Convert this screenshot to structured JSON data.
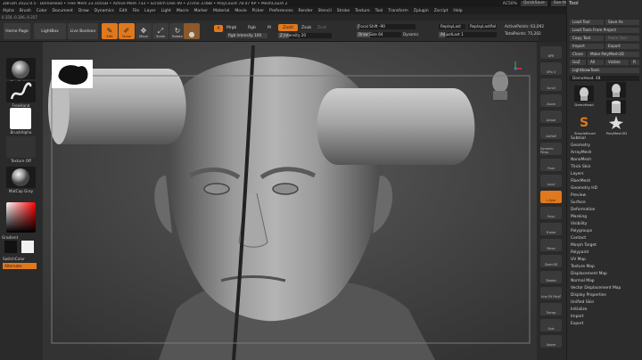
{
  "title_bar": {
    "text": "ZBrush 2022.0.5 · DemoHead • Free Mem 23.165GB • Active Mem 733 • Scratch Disk 49 • ZTime 3.088 • PolyCount 78.07 KP • MeshCount 2",
    "ac50": "AC50%",
    "quicksave": "QuickSave",
    "see_through": "See-through 0",
    "menus": "Menus",
    "default_zscript": "DefaultZScript"
  },
  "menubar": {
    "items": [
      "Alpha",
      "Brush",
      "Color",
      "Document",
      "Draw",
      "Dynamics",
      "Edit",
      "File",
      "Layer",
      "Light",
      "Macro",
      "Marker",
      "Material",
      "Movie",
      "Picker",
      "Preferences",
      "Render",
      "Stencil",
      "Stroke",
      "Texture",
      "Tool",
      "Transform",
      "Zplugin",
      "Zscript",
      "Help"
    ]
  },
  "coord_readout": "0.350,-0.306,-0.357",
  "toolbar": {
    "home_page": "Home Page",
    "lightbox": "LightBox",
    "live_boolean": "Live Boolean",
    "edit": "Edit",
    "draw": "Draw",
    "move": "Move",
    "scale": "Scale",
    "rotate": "Rotate",
    "a_label": "A",
    "mrgb": "Mrgb",
    "rgb": "Rgb",
    "m": "M",
    "zadd": "Zadd",
    "zsub": "Zsub",
    "zcut": "Zcut",
    "rgb_intensity": "Rgb Intensity 100",
    "z_intensity": "Z Intensity 20",
    "z_intensity_value": 20,
    "focal_shift": "Focal Shift -90",
    "focal_shift_value": -90,
    "draw_size": "Draw Size 64",
    "draw_size_value": 64,
    "dynamic": "Dynamic",
    "replay_last": "ReplayLast",
    "replay_last_rel": "ReplayLastRel",
    "adjust_last": "AdjustLast 1",
    "active_points": "ActivePoints: 63,092",
    "total_points": "TotalPoints: 75,202"
  },
  "left_shelf": {
    "clay_buildup": "ClayBuildup",
    "freehand": "FreeHand",
    "brush_alpha": "BrushAlpha",
    "texture_off": "Texture Off",
    "matcap_gray": "MatCap Gray",
    "gradient": "Gradient",
    "switch_color": "SwitchColor",
    "alternate": "Alternate"
  },
  "right_shelf": {
    "buttons": [
      "BPR",
      "SPix 3",
      "Scroll",
      "Zoom",
      "Actual",
      "AAHalf",
      "Dynamic Persp",
      "Floor",
      "Local",
      "L.Sym",
      "Gxyz",
      "Frame",
      "Move",
      "Zoom3D",
      "Rotate",
      "Line Fill PolyF",
      "Transp",
      "Solo",
      "Xpose"
    ]
  },
  "tool_panel": {
    "title": "Tool",
    "load_tool": "Load Tool",
    "save_as": "Save As",
    "load_from_project": "Load Tools From Project",
    "copy_tool": "Copy Tool",
    "paste_tool": "Paste Tool",
    "import": "Import",
    "export": "Export",
    "clone": "Clone",
    "make_polymesh": "Make PolyMesh3D",
    "goz": "GoZ",
    "all": "All",
    "visible": "Visible",
    "r": "R",
    "lightbox_tools": "Lightbox▸Tools",
    "demohead_slider": "DemoHead. 48",
    "thumbnails": [
      "DemoHead",
      "DemoHead",
      "Cylinder3D",
      "SimpleBrush",
      "PolyMesh3D"
    ],
    "subtool_items": [
      "Subtool",
      "Geometry",
      "ArrayMesh",
      "NanoMesh",
      "Thick Skin",
      "Layers",
      "FiberMesh",
      "Geometry HD",
      "Preview",
      "Surface",
      "Deformation",
      "Masking",
      "Visibility",
      "Polygroups",
      "Contact",
      "Morph Target",
      "Polypaint",
      "UV Map",
      "Texture Map",
      "Displacement Map",
      "Normal Map",
      "Vector Displacement Map",
      "Display Properties",
      "Unified Skin",
      "Initialize",
      "Import",
      "Export"
    ]
  },
  "colors": {
    "accent": "#e0781e",
    "panel": "#2c2c2c",
    "viewport": "#3e3e3e"
  }
}
